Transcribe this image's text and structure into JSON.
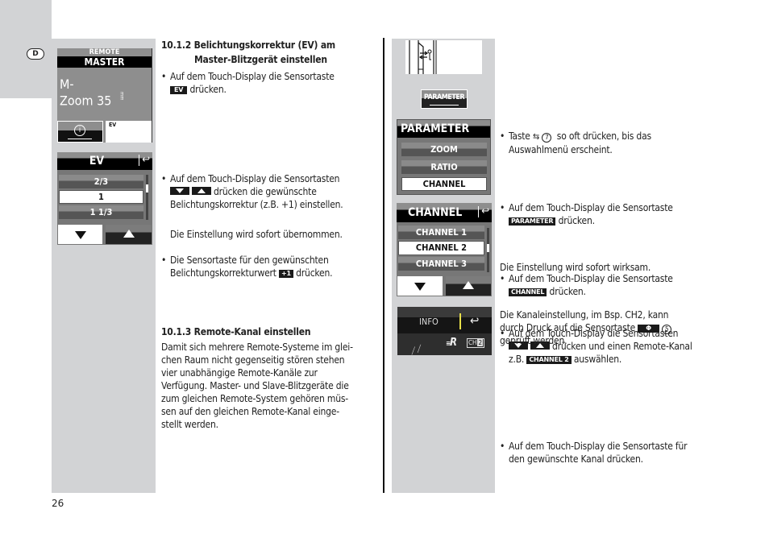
{
  "page": {
    "language_badge": "D",
    "page_number": "26"
  },
  "left_column": {
    "section_1": {
      "heading_line1": "10.1.2 Belichtungskorrektur (EV) am",
      "heading_line2": "Master-Blitzgerät einstellen",
      "bullet1_text": "Auf dem Touch-Display die Sensortaste",
      "bullet1_badge": "EV",
      "bullet1_suffix": "drücken.",
      "bullet2_line1": "Auf dem Touch-Display die Sensortasten",
      "bullet2_line2_suffix": "drücken die gewünschte",
      "bullet2_line3": "Belichtungskorrektur (z.B. +1) einstellen.",
      "bullet3_line1": "Die Sensortaste für den gewünschten",
      "bullet3_line2_prefix": "Belichtungskorrekturwert",
      "bullet3_badge": "+1",
      "bullet3_suffix": "drücken.",
      "note": "Die Einstellung wird sofort übernommen."
    },
    "section_2": {
      "heading": "10.1.3 Remote-Kanal einstellen",
      "paragraph_lines": [
        "Damit sich mehrere Remote-Systeme im glei-",
        "chen Raum nicht gegenseitig stören stehen",
        "vier unabhängige Remote-Kanäle zur",
        "Verfügung. Master- und Slave-Blitzgeräte die",
        "zum gleichen Remote-System gehören müs-",
        "sen auf den gleichen Remote-Kanal einge-",
        "stellt werden."
      ]
    }
  },
  "right_column": {
    "step1_prefix": "Taste",
    "step1_ref": "7",
    "step1_suffix": "so oft drücken, bis das",
    "step1_line2": "Auswahlmenü erscheint.",
    "step2_text": "Auf dem Touch-Display die Sensortaste",
    "step2_badge": "PARAMETER",
    "step2_suffix": "drücken.",
    "step3_text": "Auf dem Touch-Display die Sensortaste",
    "step3_badge": "CHANNEL",
    "step3_suffix": "drücken.",
    "step4_line1": "Auf dem Touch-Display die Sensortasten",
    "step4_line2_suffix": "drücken und einen Remote-Kanal",
    "step4_line3_prefix": "z.B.",
    "step4_badge": "CHANNEL 2",
    "step4_suffix": "auswählen.",
    "step5_line1": "Auf dem Touch-Display die Sensortaste für",
    "step5_line2": "den gewünschte Kanal drücken.",
    "step5_note": "Die Einstellung wird sofort wirksam.",
    "step6_line1": "Die Kanaleinstellung, im Bsp. CH2, kann",
    "step6_line2_prefix": "durch Druck auf die Sensortaste",
    "step6_badge": "Φ",
    "step6_ref": "5",
    "step6_line3": "geprüft werden."
  },
  "displays": {
    "master": {
      "label_top": "REMOTE",
      "label_title": "MASTER",
      "mode_line1": "M-",
      "mode_line2": "Zoom 35",
      "unit": "mm",
      "info_button": "i",
      "ev_label": "EV"
    },
    "ev_menu": {
      "title": "EV",
      "items": [
        "2/3",
        "1",
        "1 1/3"
      ],
      "selected_index": 1
    },
    "parameter_key": {
      "label": "PARAMETER"
    },
    "parameter_menu": {
      "title": "PARAMETER",
      "items": [
        "ZOOM",
        "RATIO",
        "CHANNEL"
      ],
      "selected_index": 2
    },
    "channel_menu": {
      "title": "CHANNEL",
      "items": [
        "CHANNEL 1",
        "CHANNEL 2",
        "CHANNEL 3"
      ],
      "selected_index": 1
    },
    "info_screen": {
      "label": "INFO",
      "remote_indicator": "R",
      "channel_badge_prefix": "CH",
      "channel_badge_value": "2"
    }
  },
  "colors": {
    "strip_gray": "#d2d3d5",
    "display_dark": "#000000",
    "info_accent": "#e8e04a"
  }
}
